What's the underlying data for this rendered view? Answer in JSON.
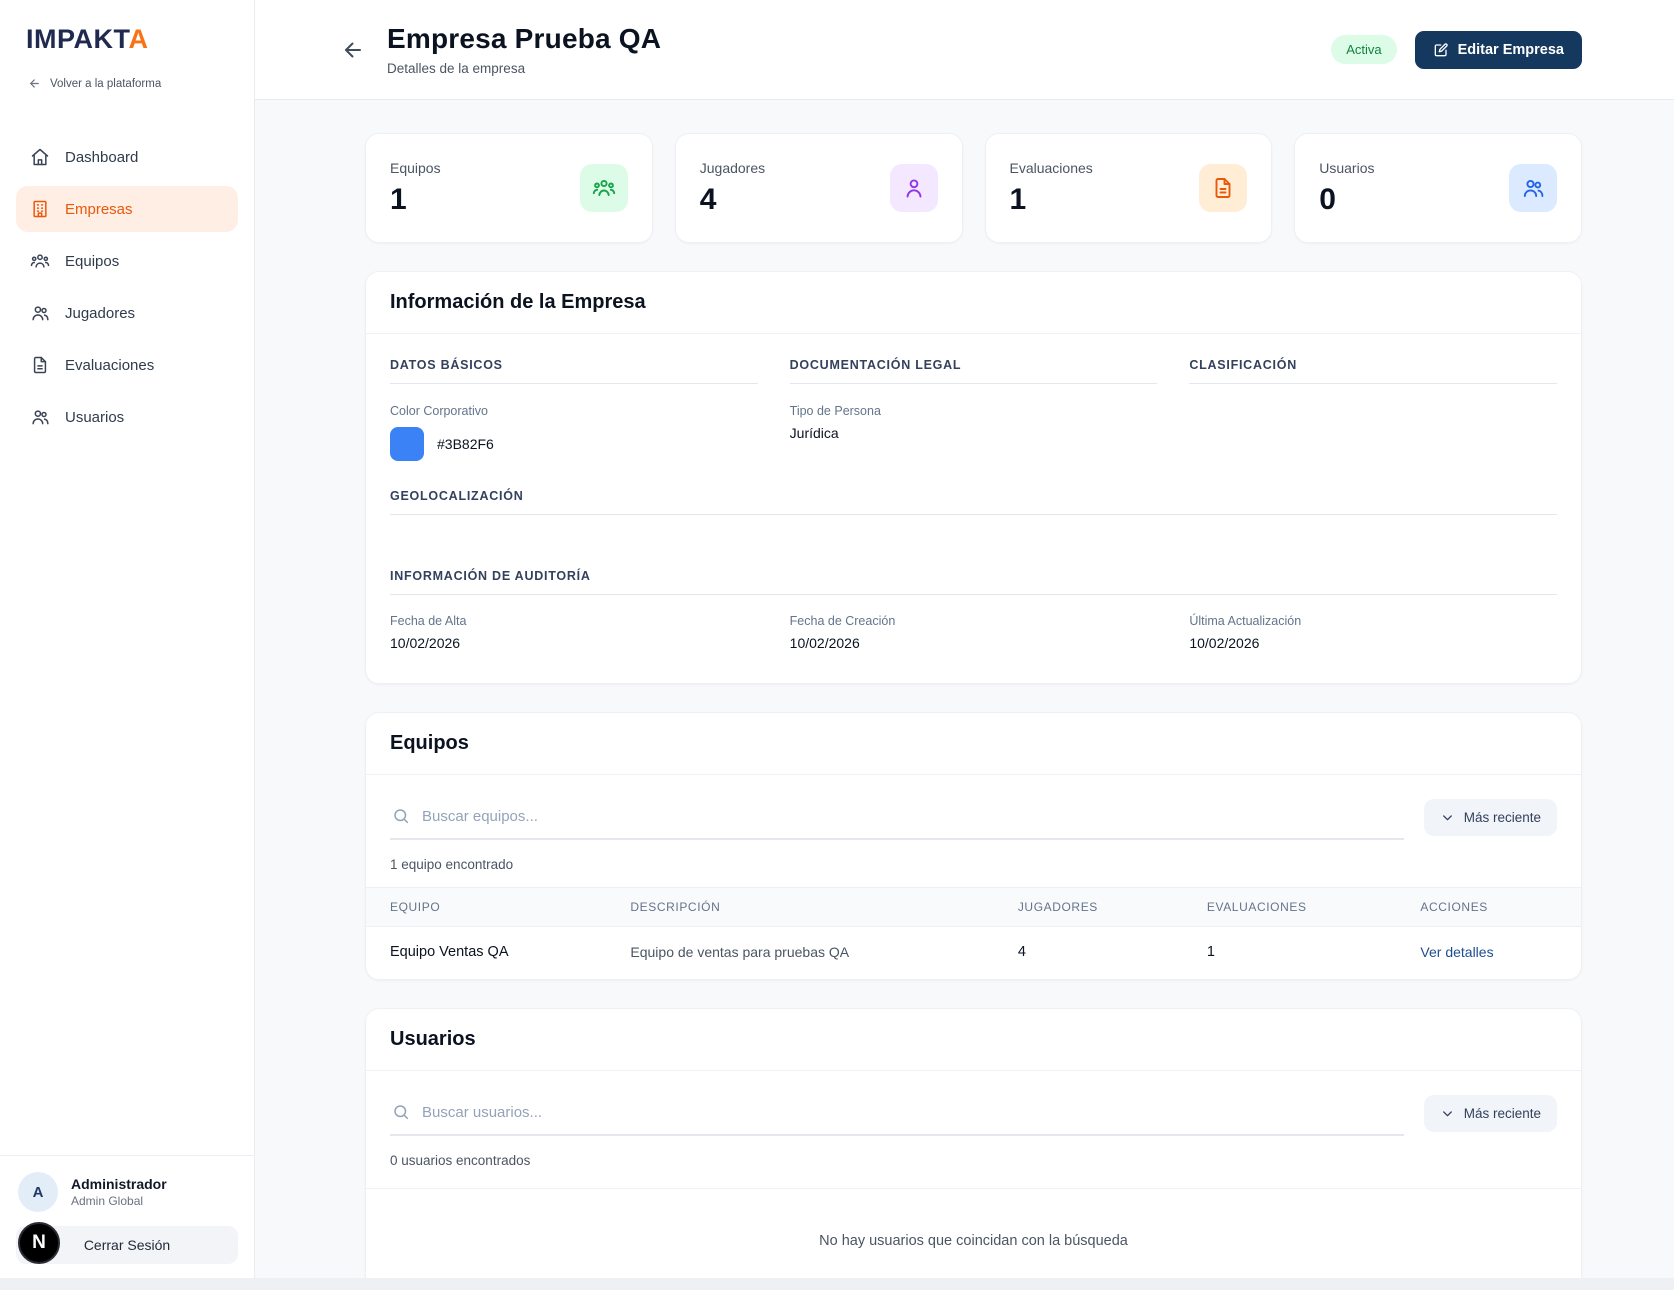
{
  "theme": {
    "accent_orange": "#ea580c",
    "accent_orange_bg": "#ffeee3",
    "brand_navy": "#1f2a4e",
    "button_navy": "#15385e",
    "status_active_bg": "#dcfce7",
    "status_active_text": "#15803d",
    "link_blue": "#1d4f8f"
  },
  "sidebar": {
    "logo": {
      "main": "IMPAKT",
      "accent": "A"
    },
    "back_link": "Volver a la plataforma",
    "items": [
      {
        "label": "Dashboard",
        "icon": "home-icon",
        "active": false
      },
      {
        "label": "Empresas",
        "icon": "building-icon",
        "active": true
      },
      {
        "label": "Equipos",
        "icon": "team-icon",
        "active": false
      },
      {
        "label": "Jugadores",
        "icon": "players-icon",
        "active": false
      },
      {
        "label": "Evaluaciones",
        "icon": "document-icon",
        "active": false
      },
      {
        "label": "Usuarios",
        "icon": "users-icon",
        "active": false
      }
    ],
    "user": {
      "initial": "A",
      "name": "Administrador",
      "role": "Admin Global"
    },
    "logout_label": "Cerrar Sesión",
    "dev_badge": "N"
  },
  "header": {
    "title": "Empresa Prueba QA",
    "subtitle": "Detalles de la empresa",
    "status_badge": "Activa",
    "edit_button": "Editar Empresa"
  },
  "stats": [
    {
      "label": "Equipos",
      "value": "1",
      "icon": "team-icon",
      "color": "#16a34a",
      "bg": "#dcfce7"
    },
    {
      "label": "Jugadores",
      "value": "4",
      "icon": "player-icon",
      "color": "#9333ea",
      "bg": "#f3e8ff"
    },
    {
      "label": "Evaluaciones",
      "value": "1",
      "icon": "document-icon",
      "color": "#ea580c",
      "bg": "#ffedd5"
    },
    {
      "label": "Usuarios",
      "value": "0",
      "icon": "users-icon",
      "color": "#2563eb",
      "bg": "#dbeafe"
    }
  ],
  "company_info": {
    "title": "Información de la Empresa",
    "sections": {
      "datos_basicos": {
        "title": "DATOS BÁSICOS",
        "color_label": "Color Corporativo",
        "color_value": "#3B82F6"
      },
      "documentacion_legal": {
        "title": "DOCUMENTACIÓN LEGAL",
        "tipo_persona_label": "Tipo de Persona",
        "tipo_persona_value": "Jurídica"
      },
      "clasificacion": {
        "title": "CLASIFICACIÓN"
      },
      "geolocalizacion": {
        "title": "GEOLOCALIZACIÓN"
      },
      "auditoria": {
        "title": "INFORMACIÓN DE AUDITORÍA",
        "fields": [
          {
            "label": "Fecha de Alta",
            "value": "10/02/2026"
          },
          {
            "label": "Fecha de Creación",
            "value": "10/02/2026"
          },
          {
            "label": "Última Actualización",
            "value": "10/02/2026"
          }
        ]
      }
    }
  },
  "equipos_section": {
    "title": "Equipos",
    "search_placeholder": "Buscar equipos...",
    "sort_label": "Más reciente",
    "count_text": "1 equipo encontrado",
    "table": {
      "headers": [
        "EQUIPO",
        "DESCRIPCIÓN",
        "JUGADORES",
        "EVALUACIONES",
        "ACCIONES"
      ],
      "rows": [
        {
          "equipo": "Equipo Ventas QA",
          "descripcion": "Equipo de ventas para pruebas QA",
          "jugadores": "4",
          "evaluaciones": "1",
          "accion": "Ver detalles"
        }
      ]
    }
  },
  "usuarios_section": {
    "title": "Usuarios",
    "search_placeholder": "Buscar usuarios...",
    "sort_label": "Más reciente",
    "count_text": "0 usuarios encontrados",
    "empty_message": "No hay usuarios que coincidan con la búsqueda"
  }
}
